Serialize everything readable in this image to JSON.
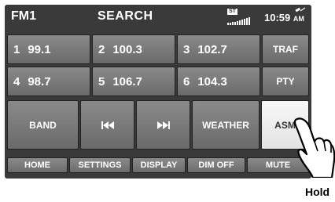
{
  "topbar": {
    "band": "FM1",
    "mode": "SEARCH",
    "stereo": "ST",
    "time": "10:59",
    "ampm": "AM"
  },
  "presets": [
    {
      "num": "1",
      "freq": "99.1"
    },
    {
      "num": "2",
      "freq": "100.3"
    },
    {
      "num": "3",
      "freq": "102.7"
    },
    {
      "num": "4",
      "freq": "98.7"
    },
    {
      "num": "5",
      "freq": "106.7"
    },
    {
      "num": "6",
      "freq": "104.3"
    }
  ],
  "side": {
    "traf": "TRAF",
    "pty": "PTY"
  },
  "controls": {
    "band": "BAND",
    "weather": "WEATHER",
    "asm": "ASM"
  },
  "menu": {
    "home": "HOME",
    "settings": "SETTINGS",
    "display": "DISPLAY",
    "dim": "DIM OFF",
    "mute": "MUTE"
  },
  "caption": "Hold"
}
